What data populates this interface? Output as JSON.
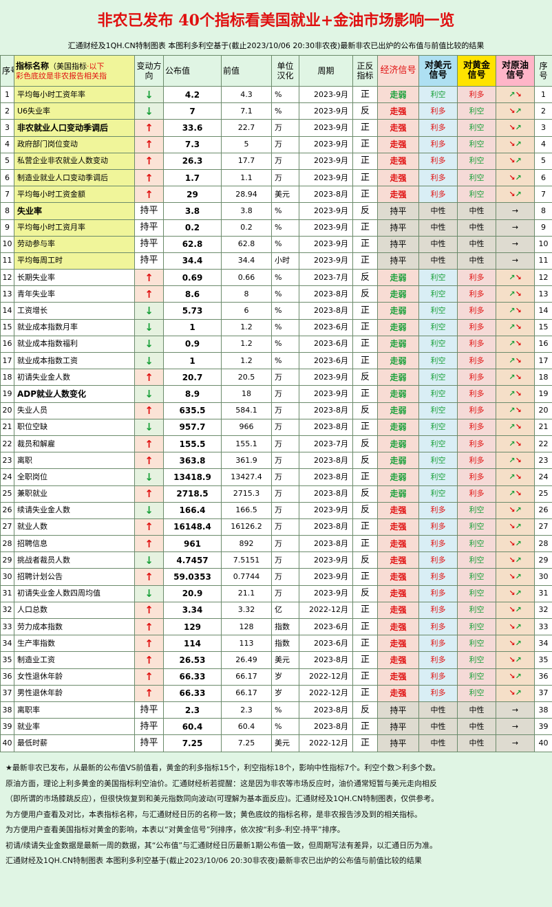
{
  "title": "非农已发布  40个指标看美国就业+金油市场影响一览",
  "subtitle": "汇通财经及1QH.CN特制图表 本图利多利空基于(截止2023/10/06 20:30非农夜)最新非农已出炉的公布值与前值比较的结果",
  "headers": {
    "idx": "序号",
    "name_main": "指标名称",
    "name_paren": "（美国指标",
    "name_below": "·以下",
    "name_line2": "彩色底纹是非农报告相关指",
    "dir": "变动方向",
    "pub": "公布值",
    "prev": "前值",
    "unit": "单位汉化",
    "period": "周期",
    "sign": "正反指标",
    "eco": "经济信号",
    "usd": "对美元信号",
    "gold": "对黄金信号",
    "oil": "对原油信号",
    "idx2": "序号"
  },
  "colors": {
    "title_red": "#e01010",
    "bull_green": "#1aa03a",
    "bear_red": "#e01010",
    "usd_header": "#aee0f2",
    "gold_header": "#ffe300",
    "oil_header": "#ffb5c8",
    "nfp_highlight": "#f0f59a"
  },
  "rows": [
    {
      "idx": "1",
      "name": "平均每小时工资年率",
      "nfp": true,
      "bold": false,
      "dir": "down",
      "dir_text": "↓",
      "pub": "4.2",
      "prev": "4.3",
      "unit": "%",
      "period": "2023-9月",
      "sign": "正",
      "eco": "走弱",
      "usd": "利空",
      "gold": "利多",
      "oil": "↗↘"
    },
    {
      "idx": "2",
      "name": "U6失业率",
      "nfp": true,
      "bold": false,
      "dir": "down",
      "dir_text": "↓",
      "pub": "7",
      "prev": "7.1",
      "unit": "%",
      "period": "2023-9月",
      "sign": "反",
      "eco": "走强",
      "usd": "利多",
      "gold": "利空",
      "oil": "↘↗"
    },
    {
      "idx": "3",
      "name": "非农就业人口变动季调后",
      "nfp": true,
      "bold": true,
      "dir": "up",
      "dir_text": "↑",
      "pub": "33.6",
      "prev": "22.7",
      "unit": "万",
      "period": "2023-9月",
      "sign": "正",
      "eco": "走强",
      "usd": "利多",
      "gold": "利空",
      "oil": "↘↗"
    },
    {
      "idx": "4",
      "name": "政府部门岗位变动",
      "nfp": true,
      "bold": false,
      "dir": "up",
      "dir_text": "↑",
      "pub": "7.3",
      "prev": "5",
      "unit": "万",
      "period": "2023-9月",
      "sign": "正",
      "eco": "走强",
      "usd": "利多",
      "gold": "利空",
      "oil": "↘↗"
    },
    {
      "idx": "5",
      "name": "私营企业非农就业人数变动",
      "nfp": true,
      "bold": false,
      "dir": "up",
      "dir_text": "↑",
      "pub": "26.3",
      "prev": "17.7",
      "unit": "万",
      "period": "2023-9月",
      "sign": "正",
      "eco": "走强",
      "usd": "利多",
      "gold": "利空",
      "oil": "↘↗"
    },
    {
      "idx": "6",
      "name": "制造业就业人口变动季调后",
      "nfp": true,
      "bold": false,
      "dir": "up",
      "dir_text": "↑",
      "pub": "1.7",
      "prev": "1.1",
      "unit": "万",
      "period": "2023-9月",
      "sign": "正",
      "eco": "走强",
      "usd": "利多",
      "gold": "利空",
      "oil": "↘↗"
    },
    {
      "idx": "7",
      "name": "平均每小时工资金额",
      "nfp": true,
      "bold": false,
      "dir": "up",
      "dir_text": "↑",
      "pub": "29",
      "prev": "28.94",
      "unit": "美元",
      "period": "2023-8月",
      "sign": "正",
      "eco": "走强",
      "usd": "利多",
      "gold": "利空",
      "oil": "↘↗"
    },
    {
      "idx": "8",
      "name": "失业率",
      "nfp": true,
      "bold": true,
      "dir": "flat",
      "dir_text": "持平",
      "pub": "3.8",
      "prev": "3.8",
      "unit": "%",
      "period": "2023-9月",
      "sign": "反",
      "eco": "持平",
      "usd": "中性",
      "gold": "中性",
      "oil": "→"
    },
    {
      "idx": "9",
      "name": "平均每小时工资月率",
      "nfp": true,
      "bold": false,
      "dir": "flat",
      "dir_text": "持平",
      "pub": "0.2",
      "prev": "0.2",
      "unit": "%",
      "period": "2023-9月",
      "sign": "正",
      "eco": "持平",
      "usd": "中性",
      "gold": "中性",
      "oil": "→"
    },
    {
      "idx": "10",
      "name": "劳动参与率",
      "nfp": true,
      "bold": false,
      "dir": "flat",
      "dir_text": "持平",
      "pub": "62.8",
      "prev": "62.8",
      "unit": "%",
      "period": "2023-9月",
      "sign": "正",
      "eco": "持平",
      "usd": "中性",
      "gold": "中性",
      "oil": "→"
    },
    {
      "idx": "11",
      "name": "平均每周工时",
      "nfp": true,
      "bold": false,
      "dir": "flat",
      "dir_text": "持平",
      "pub": "34.4",
      "prev": "34.4",
      "unit": "小时",
      "period": "2023-9月",
      "sign": "正",
      "eco": "持平",
      "usd": "中性",
      "gold": "中性",
      "oil": "→"
    },
    {
      "idx": "12",
      "name": "长期失业率",
      "nfp": false,
      "bold": false,
      "dir": "up",
      "dir_text": "↑",
      "pub": "0.69",
      "prev": "0.66",
      "unit": "%",
      "period": "2023-7月",
      "sign": "反",
      "eco": "走弱",
      "usd": "利空",
      "gold": "利多",
      "oil": "↗↘"
    },
    {
      "idx": "13",
      "name": "青年失业率",
      "nfp": false,
      "bold": false,
      "dir": "up",
      "dir_text": "↑",
      "pub": "8.6",
      "prev": "8",
      "unit": "%",
      "period": "2023-8月",
      "sign": "反",
      "eco": "走弱",
      "usd": "利空",
      "gold": "利多",
      "oil": "↗↘"
    },
    {
      "idx": "14",
      "name": "工资增长",
      "nfp": false,
      "bold": false,
      "dir": "down",
      "dir_text": "↓",
      "pub": "5.73",
      "prev": "6",
      "unit": "%",
      "period": "2023-8月",
      "sign": "正",
      "eco": "走弱",
      "usd": "利空",
      "gold": "利多",
      "oil": "↗↘"
    },
    {
      "idx": "15",
      "name": "就业成本指数月率",
      "nfp": false,
      "bold": false,
      "dir": "down",
      "dir_text": "↓",
      "pub": "1",
      "prev": "1.2",
      "unit": "%",
      "period": "2023-6月",
      "sign": "正",
      "eco": "走弱",
      "usd": "利空",
      "gold": "利多",
      "oil": "↗↘"
    },
    {
      "idx": "16",
      "name": "就业成本指数福利",
      "nfp": false,
      "bold": false,
      "dir": "down",
      "dir_text": "↓",
      "pub": "0.9",
      "prev": "1.2",
      "unit": "%",
      "period": "2023-6月",
      "sign": "正",
      "eco": "走弱",
      "usd": "利空",
      "gold": "利多",
      "oil": "↗↘"
    },
    {
      "idx": "17",
      "name": "就业成本指数工资",
      "nfp": false,
      "bold": false,
      "dir": "down",
      "dir_text": "↓",
      "pub": "1",
      "prev": "1.2",
      "unit": "%",
      "period": "2023-6月",
      "sign": "正",
      "eco": "走弱",
      "usd": "利空",
      "gold": "利多",
      "oil": "↗↘"
    },
    {
      "idx": "18",
      "name": "初请失业金人数",
      "nfp": false,
      "bold": false,
      "dir": "up",
      "dir_text": "↑",
      "pub": "20.7",
      "prev": "20.5",
      "unit": "万",
      "period": "2023-9月",
      "sign": "反",
      "eco": "走弱",
      "usd": "利空",
      "gold": "利多",
      "oil": "↗↘"
    },
    {
      "idx": "19",
      "name": "ADP就业人数变化",
      "nfp": false,
      "bold": true,
      "dir": "down",
      "dir_text": "↓",
      "pub": "8.9",
      "prev": "18",
      "unit": "万",
      "period": "2023-9月",
      "sign": "正",
      "eco": "走弱",
      "usd": "利空",
      "gold": "利多",
      "oil": "↗↘"
    },
    {
      "idx": "20",
      "name": "失业人员",
      "nfp": false,
      "bold": false,
      "dir": "up",
      "dir_text": "↑",
      "pub": "635.5",
      "prev": "584.1",
      "unit": "万",
      "period": "2023-8月",
      "sign": "反",
      "eco": "走弱",
      "usd": "利空",
      "gold": "利多",
      "oil": "↗↘"
    },
    {
      "idx": "21",
      "name": "职位空缺",
      "nfp": false,
      "bold": false,
      "dir": "down",
      "dir_text": "↓",
      "pub": "957.7",
      "prev": "966",
      "unit": "万",
      "period": "2023-8月",
      "sign": "正",
      "eco": "走弱",
      "usd": "利空",
      "gold": "利多",
      "oil": "↗↘"
    },
    {
      "idx": "22",
      "name": "裁员和解雇",
      "nfp": false,
      "bold": false,
      "dir": "up",
      "dir_text": "↑",
      "pub": "155.5",
      "prev": "155.1",
      "unit": "万",
      "period": "2023-7月",
      "sign": "反",
      "eco": "走弱",
      "usd": "利空",
      "gold": "利多",
      "oil": "↗↘"
    },
    {
      "idx": "23",
      "name": "离职",
      "nfp": false,
      "bold": false,
      "dir": "up",
      "dir_text": "↑",
      "pub": "363.8",
      "prev": "361.9",
      "unit": "万",
      "period": "2023-8月",
      "sign": "反",
      "eco": "走弱",
      "usd": "利空",
      "gold": "利多",
      "oil": "↗↘"
    },
    {
      "idx": "24",
      "name": "全职岗位",
      "nfp": false,
      "bold": false,
      "dir": "down",
      "dir_text": "↓",
      "pub": "13418.9",
      "prev": "13427.4",
      "unit": "万",
      "period": "2023-8月",
      "sign": "正",
      "eco": "走弱",
      "usd": "利空",
      "gold": "利多",
      "oil": "↗↘"
    },
    {
      "idx": "25",
      "name": "兼职就业",
      "nfp": false,
      "bold": false,
      "dir": "up",
      "dir_text": "↑",
      "pub": "2718.5",
      "prev": "2715.3",
      "unit": "万",
      "period": "2023-8月",
      "sign": "反",
      "eco": "走弱",
      "usd": "利空",
      "gold": "利多",
      "oil": "↗↘"
    },
    {
      "idx": "26",
      "name": "续请失业金人数",
      "nfp": false,
      "bold": false,
      "dir": "down",
      "dir_text": "↓",
      "pub": "166.4",
      "prev": "166.5",
      "unit": "万",
      "period": "2023-9月",
      "sign": "反",
      "eco": "走强",
      "usd": "利多",
      "gold": "利空",
      "oil": "↘↗"
    },
    {
      "idx": "27",
      "name": "就业人数",
      "nfp": false,
      "bold": false,
      "dir": "up",
      "dir_text": "↑",
      "pub": "16148.4",
      "prev": "16126.2",
      "unit": "万",
      "period": "2023-8月",
      "sign": "正",
      "eco": "走强",
      "usd": "利多",
      "gold": "利空",
      "oil": "↘↗"
    },
    {
      "idx": "28",
      "name": "招聘信息",
      "nfp": false,
      "bold": false,
      "dir": "up",
      "dir_text": "↑",
      "pub": "961",
      "prev": "892",
      "unit": "万",
      "period": "2023-8月",
      "sign": "正",
      "eco": "走强",
      "usd": "利多",
      "gold": "利空",
      "oil": "↘↗"
    },
    {
      "idx": "29",
      "name": "挑战者裁员人数",
      "nfp": false,
      "bold": false,
      "dir": "down",
      "dir_text": "↓",
      "pub": "4.7457",
      "prev": "7.5151",
      "unit": "万",
      "period": "2023-9月",
      "sign": "反",
      "eco": "走强",
      "usd": "利多",
      "gold": "利空",
      "oil": "↘↗"
    },
    {
      "idx": "30",
      "name": "招聘计划公告",
      "nfp": false,
      "bold": false,
      "dir": "up",
      "dir_text": "↑",
      "pub": "59.0353",
      "prev": "0.7744",
      "unit": "万",
      "period": "2023-9月",
      "sign": "正",
      "eco": "走强",
      "usd": "利多",
      "gold": "利空",
      "oil": "↘↗"
    },
    {
      "idx": "31",
      "name": "初请失业金人数四周均值",
      "nfp": false,
      "bold": false,
      "dir": "down",
      "dir_text": "↓",
      "pub": "20.9",
      "prev": "21.1",
      "unit": "万",
      "period": "2023-9月",
      "sign": "反",
      "eco": "走强",
      "usd": "利多",
      "gold": "利空",
      "oil": "↘↗"
    },
    {
      "idx": "32",
      "name": "人口总数",
      "nfp": false,
      "bold": false,
      "dir": "up",
      "dir_text": "↑",
      "pub": "3.34",
      "prev": "3.32",
      "unit": "亿",
      "period": "2022-12月",
      "sign": "正",
      "eco": "走强",
      "usd": "利多",
      "gold": "利空",
      "oil": "↘↗"
    },
    {
      "idx": "33",
      "name": "劳力成本指数",
      "nfp": false,
      "bold": false,
      "dir": "up",
      "dir_text": "↑",
      "pub": "129",
      "prev": "128",
      "unit": "指数",
      "period": "2023-6月",
      "sign": "正",
      "eco": "走强",
      "usd": "利多",
      "gold": "利空",
      "oil": "↘↗"
    },
    {
      "idx": "34",
      "name": "生产率指数",
      "nfp": false,
      "bold": false,
      "dir": "up",
      "dir_text": "↑",
      "pub": "114",
      "prev": "113",
      "unit": "指数",
      "period": "2023-6月",
      "sign": "正",
      "eco": "走强",
      "usd": "利多",
      "gold": "利空",
      "oil": "↘↗"
    },
    {
      "idx": "35",
      "name": "制造业工资",
      "nfp": false,
      "bold": false,
      "dir": "up",
      "dir_text": "↑",
      "pub": "26.53",
      "prev": "26.49",
      "unit": "美元",
      "period": "2023-8月",
      "sign": "正",
      "eco": "走强",
      "usd": "利多",
      "gold": "利空",
      "oil": "↘↗"
    },
    {
      "idx": "36",
      "name": "女性退休年龄",
      "nfp": false,
      "bold": false,
      "dir": "up",
      "dir_text": "↑",
      "pub": "66.33",
      "prev": "66.17",
      "unit": "岁",
      "period": "2022-12月",
      "sign": "正",
      "eco": "走强",
      "usd": "利多",
      "gold": "利空",
      "oil": "↘↗"
    },
    {
      "idx": "37",
      "name": "男性退休年龄",
      "nfp": false,
      "bold": false,
      "dir": "up",
      "dir_text": "↑",
      "pub": "66.33",
      "prev": "66.17",
      "unit": "岁",
      "period": "2022-12月",
      "sign": "正",
      "eco": "走强",
      "usd": "利多",
      "gold": "利空",
      "oil": "↘↗"
    },
    {
      "idx": "38",
      "name": "离职率",
      "nfp": false,
      "bold": false,
      "dir": "flat",
      "dir_text": "持平",
      "pub": "2.3",
      "prev": "2.3",
      "unit": "%",
      "period": "2023-8月",
      "sign": "反",
      "eco": "持平",
      "usd": "中性",
      "gold": "中性",
      "oil": "→"
    },
    {
      "idx": "39",
      "name": "就业率",
      "nfp": false,
      "bold": false,
      "dir": "flat",
      "dir_text": "持平",
      "pub": "60.4",
      "prev": "60.4",
      "unit": "%",
      "period": "2023-8月",
      "sign": "正",
      "eco": "持平",
      "usd": "中性",
      "gold": "中性",
      "oil": "→"
    },
    {
      "idx": "40",
      "name": "最低时薪",
      "nfp": false,
      "bold": false,
      "dir": "flat",
      "dir_text": "持平",
      "pub": "7.25",
      "prev": "7.25",
      "unit": "美元",
      "period": "2022-12月",
      "sign": "正",
      "eco": "持平",
      "usd": "中性",
      "gold": "中性",
      "oil": "→"
    }
  ],
  "notes": [
    "★最新非农已发布，从最新的公布值VS前值看，黄金的利多指标15个，利空指标18个，影响中性指标7个。利空个数＞利多个数。",
    "原油方面，理论上利多黄金的美国指标利空油价。汇通财经析若提醒：这是因为非农等市场反应时，油价通常短暂与美元走向相反",
    "（即所谓的市场膝跳反应），但很快恢复到和美元指数同向波动(可理解为基本面反应)。汇通财经及1QH.CN特制图表，仅供参考。",
    "为方便用户查看及对比，本表指标名称，与汇通财经日历的名称一致；黄色底纹的指标名称，是非农报告涉及到的相关指标。",
    "为方便用户查看美国指标对黄金的影响，本表以“对黄金信号”列排序，依次按“利多-利空-持平”排序。",
    "初请/续请失业金数据是最新一周的数据，其“公布值”与汇通财经日历最新1期公布值一致，但周期写法有差异，以汇通日历为准。",
    "汇通财经及1QH.CN特制图表 本图利多利空基于(截止2023/10/06 20:30非农夜)最新非农已出炉的公布值与前值比较的结果"
  ]
}
